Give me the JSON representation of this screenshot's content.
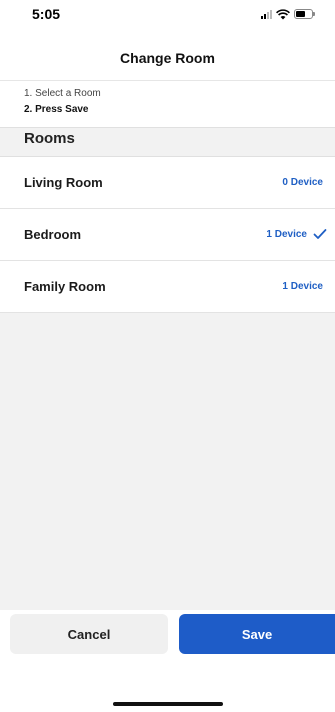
{
  "status_bar": {
    "time": "5:05"
  },
  "header": {
    "title": "Change Room"
  },
  "instructions": {
    "step1": "1. Select a Room",
    "step2": "2. Press Save"
  },
  "section": {
    "title": "Rooms"
  },
  "rooms": [
    {
      "name": "Living Room",
      "devices": "0 Device",
      "selected": false
    },
    {
      "name": "Bedroom",
      "devices": "1 Device",
      "selected": true
    },
    {
      "name": "Family Room",
      "devices": "1 Device",
      "selected": false
    }
  ],
  "actions": {
    "cancel_label": "Cancel",
    "save_label": "Save"
  },
  "colors": {
    "accent": "#1e5cc8",
    "link_blue": "#1f5fc4",
    "background": "#f2f2f2"
  },
  "icons": {
    "checkmark": "checkmark-icon",
    "signal": "cellular-signal-icon",
    "wifi": "wifi-icon",
    "battery": "battery-icon"
  }
}
